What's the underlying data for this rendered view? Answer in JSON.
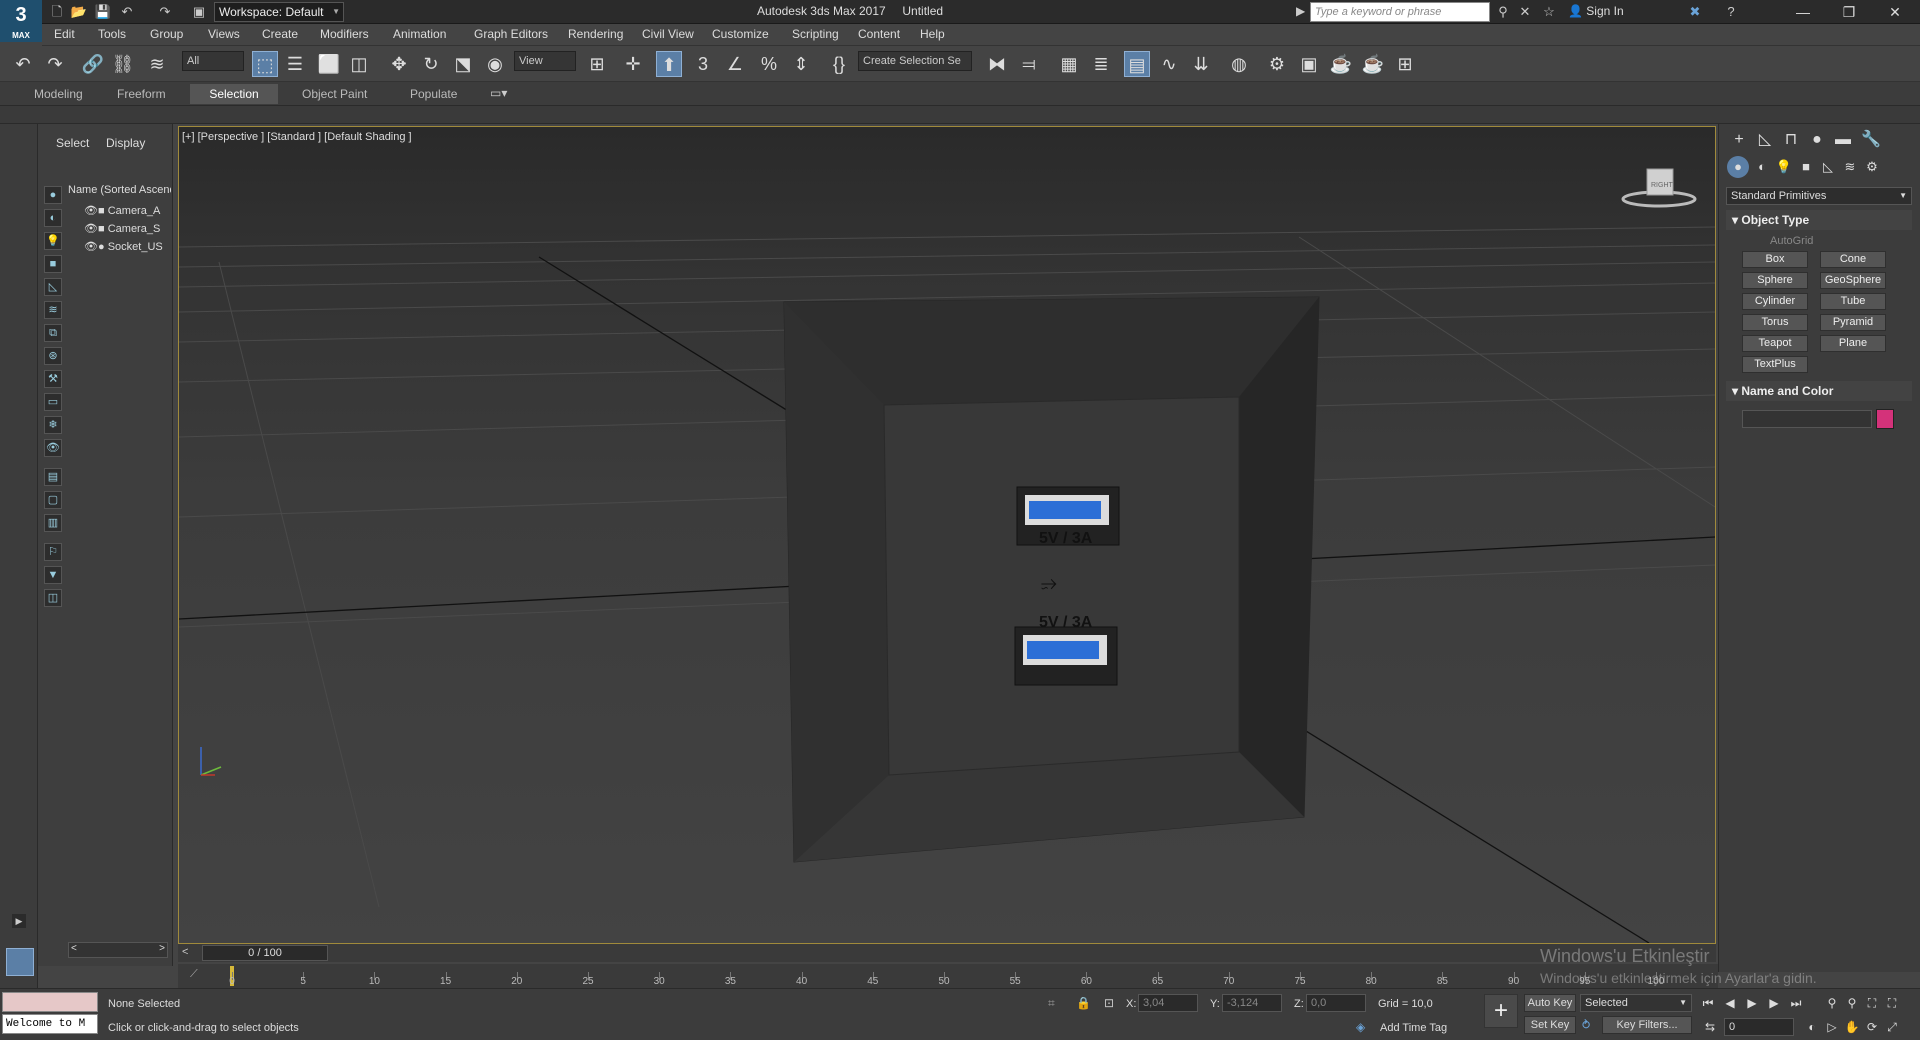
{
  "app": {
    "title": "Autodesk 3ds Max 2017",
    "document": "Untitled",
    "logo_text": "3",
    "logo_sub": "MAX"
  },
  "workspace": {
    "label": "Workspace: Default"
  },
  "search": {
    "placeholder": "Type a keyword or phrase"
  },
  "account": {
    "sign_in": "Sign In"
  },
  "menu": [
    "Edit",
    "Tools",
    "Group",
    "Views",
    "Create",
    "Modifiers",
    "Animation",
    "Graph Editors",
    "Rendering",
    "Civil View",
    "Customize",
    "Scripting",
    "Content",
    "Help"
  ],
  "toolbar": {
    "selection_filter": "All",
    "ref_coord": "View",
    "named_selection": "Create Selection Se"
  },
  "ribbon": {
    "tabs": [
      "Modeling",
      "Freeform",
      "Selection",
      "Object Paint",
      "Populate"
    ],
    "active": "Selection"
  },
  "scene_explorer": {
    "tabs": [
      "Select",
      "Display"
    ],
    "column_header": "Name (Sorted Ascending)",
    "items": [
      {
        "name": "Camera_A",
        "icon": "camera-icon"
      },
      {
        "name": "Camera_S",
        "icon": "camera-icon"
      },
      {
        "name": "Socket_US",
        "icon": "sphere-icon"
      }
    ]
  },
  "viewport": {
    "label": "[+] [Perspective ] [Standard ] [Default Shading ]",
    "viewcube_label": "RIGHT",
    "socket_labels": [
      "5V / 3A",
      "5V / 3A"
    ]
  },
  "command_panel": {
    "category_dropdown": "Standard Primitives",
    "object_type": {
      "title": "Object Type",
      "autogrid": "AutoGrid",
      "buttons": [
        "Box",
        "Cone",
        "Sphere",
        "GeoSphere",
        "Cylinder",
        "Tube",
        "Torus",
        "Pyramid",
        "Teapot",
        "Plane",
        "TextPlus"
      ]
    },
    "name_and_color": {
      "title": "Name and Color",
      "color": "#d4327a"
    }
  },
  "timeline": {
    "slider": "0 / 100",
    "ticks": [
      0,
      5,
      10,
      15,
      20,
      25,
      30,
      35,
      40,
      45,
      50,
      55,
      60,
      65,
      70,
      75,
      80,
      85,
      90,
      95,
      100
    ]
  },
  "status": {
    "maxscript_text": "Welcome to M",
    "selection": "None Selected",
    "prompt": "Click or click-and-drag to select objects",
    "x_label": "X:",
    "x_value": "3,04",
    "y_label": "Y:",
    "y_value": "-3,124",
    "z_label": "Z:",
    "z_value": "0,0",
    "grid": "Grid = 10,0",
    "add_time_tag": "Add Time Tag"
  },
  "animation": {
    "auto_key": "Auto Key",
    "set_key": "Set Key",
    "selected": "Selected",
    "key_filters": "Key Filters...",
    "frame": "0"
  },
  "watermark": {
    "line1": "Windows'u Etkinleştir",
    "line2": "Windows'u etkinleştirmek için Ayarlar'a gidin."
  }
}
